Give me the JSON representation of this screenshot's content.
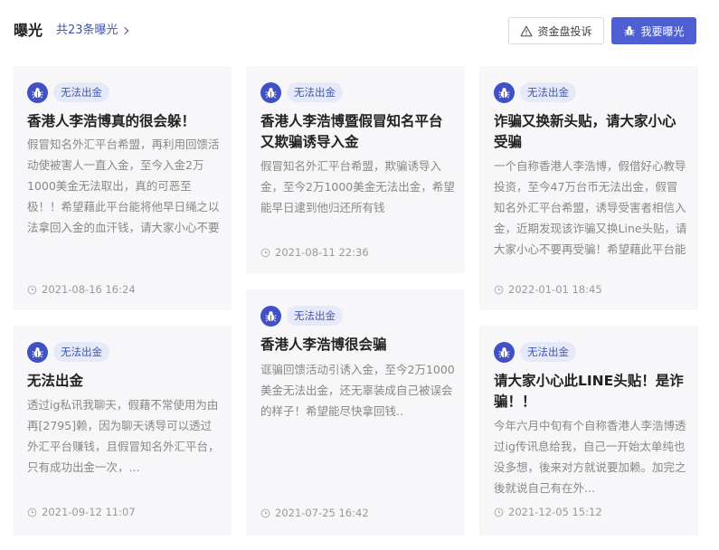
{
  "header": {
    "title": "曝光",
    "count_link": "共23条曝光",
    "complaint_button": "资金盘投诉",
    "expose_button": "我要曝光"
  },
  "icons": {
    "complaint": "warning-triangle-icon",
    "expose": "bug-icon",
    "tag": "bug-icon",
    "date": "clock-icon",
    "count": "chevron-right-icon"
  },
  "colors": {
    "accent": "#4d5fd1",
    "link": "#3d55b6",
    "tag_bg": "#e6eaf8",
    "card_bg": "#f7f7f9"
  },
  "cards": [
    {
      "tag": "无法出金",
      "title": "香港人李浩博真的很会躲！",
      "body": "假冒知名外汇平台希盟，再利用回馈活动使被害人一直入金，至今入金2万1000美金无法取出，真的可恶至极！！希望藉此平台能将他早日绳之以法拿回入金的血汗钱，请大家小心不要再被受骗！",
      "date": "2021-08-16 16:24"
    },
    {
      "tag": "无法出金",
      "title": "香港人李浩博暨假冒知名平台又欺骗诱导入金",
      "body": "假冒知名外汇平台希盟，欺骗诱导入金，至今2万1000美金无法出金，希望能早日逮到他归还所有钱",
      "date": "2021-08-11 22:36"
    },
    {
      "tag": "无法出金",
      "title": "诈骗又换新头贴，请大家小心受骗",
      "body": "一个自称香港人李浩博，假借好心教导投资，至今47万台币无法出金，假冒知名外汇平台希盟，诱导受害者相信入金，近期发现该诈骗又换Line头贴，请大家小心不要再受骗！希望藉此平台能早日将诈...",
      "date": "2022-01-01 18:45"
    },
    {
      "tag": "无法出金",
      "title": "无法出金",
      "body": "透过ig私讯我聊天，假藉不常使用为由再[2795]赖，因为聊天诱导可以透过外汇平台赚钱，且假冒知名外汇平台，只有成功出金一次，...",
      "date": "2021-09-12 11:07"
    },
    {
      "tag": "无法出金",
      "title": "香港人李浩博很会骗",
      "body": "诓骗回馈活动引诱入金，至今2万1000美金无法出金，还无辜装成自己被误会的样子！希望能尽快拿回钱..",
      "date": "2021-07-25 16:42"
    },
    {
      "tag": "无法出金",
      "title": "请大家小心此LINE头贴！是诈骗！！",
      "body": "今年六月中旬有个自称香港人李浩博透过ig传讯息给我，自己一开始太单纯也没多想，後来对方就说要加赖。加完之後就说自己有在外...",
      "date": "2021-12-05 15:12"
    }
  ]
}
